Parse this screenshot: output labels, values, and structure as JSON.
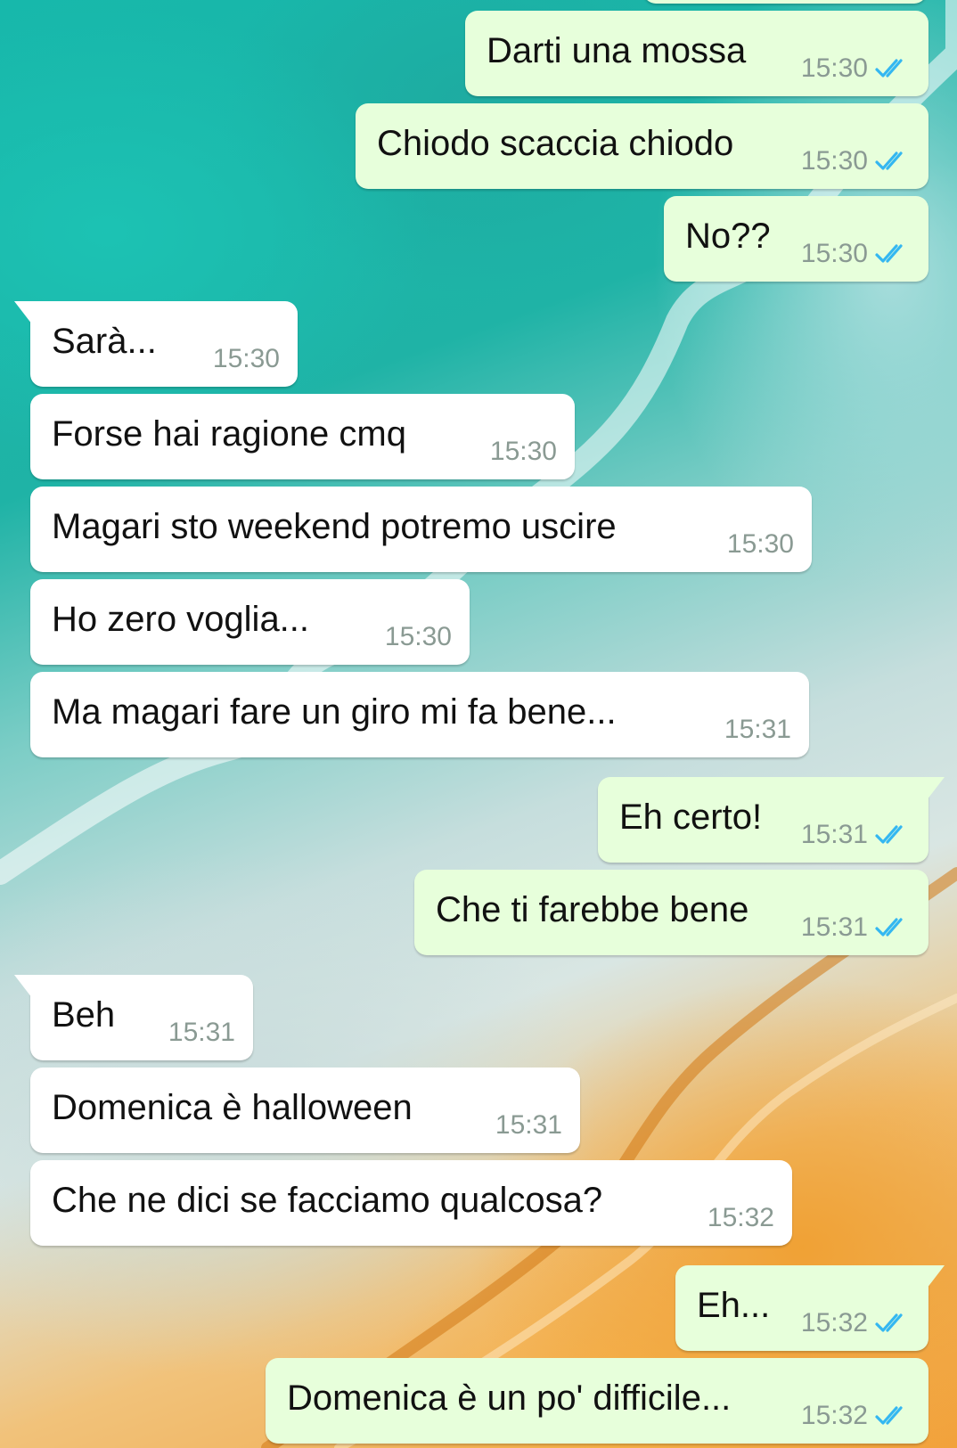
{
  "colors": {
    "outgoing_bubble": "#e7ffdb",
    "incoming_bubble": "#ffffff",
    "read_checks": "#34b7f1",
    "timestamp": "#8a9a93"
  },
  "icons": {
    "read_receipt": "double-check-icon"
  },
  "messages": [
    {
      "direction": "out",
      "text": "Darti una mossa",
      "time": "15:30",
      "read": true
    },
    {
      "direction": "out",
      "text": "Chiodo scaccia chiodo",
      "time": "15:30",
      "read": true
    },
    {
      "direction": "out",
      "text": "No??",
      "time": "15:30",
      "read": true
    },
    {
      "direction": "in",
      "text": "Sarà...",
      "time": "15:30"
    },
    {
      "direction": "in",
      "text": "Forse hai ragione cmq",
      "time": "15:30"
    },
    {
      "direction": "in",
      "text": "Magari sto weekend potremo uscire",
      "time": "15:30"
    },
    {
      "direction": "in",
      "text": "Ho zero voglia...",
      "time": "15:30"
    },
    {
      "direction": "in",
      "text": "Ma magari fare un giro mi fa bene...",
      "time": "15:31"
    },
    {
      "direction": "out",
      "text": "Eh certo!",
      "time": "15:31",
      "read": true
    },
    {
      "direction": "out",
      "text": "Che ti farebbe bene",
      "time": "15:31",
      "read": true
    },
    {
      "direction": "in",
      "text": "Beh",
      "time": "15:31"
    },
    {
      "direction": "in",
      "text": "Domenica è halloween",
      "time": "15:31"
    },
    {
      "direction": "in",
      "text": "Che ne dici se facciamo qualcosa?",
      "time": "15:32"
    },
    {
      "direction": "out",
      "text": "Eh...",
      "time": "15:32",
      "read": true
    },
    {
      "direction": "out",
      "text": "Domenica è un po' difficile...",
      "time": "15:32",
      "read": true
    }
  ]
}
